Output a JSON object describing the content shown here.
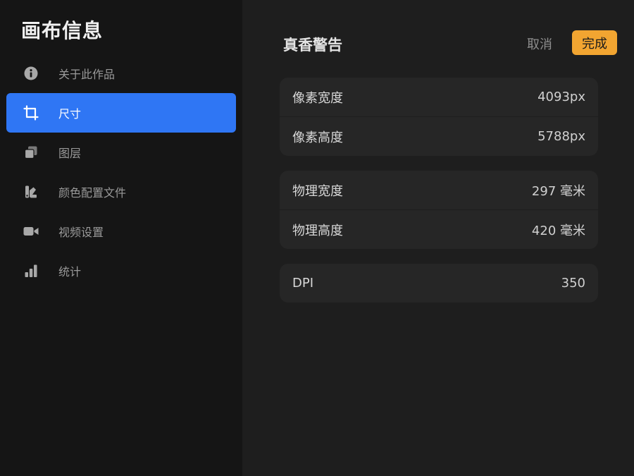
{
  "sidebar": {
    "title": "画布信息",
    "items": [
      {
        "label": "关于此作品",
        "icon": "info-icon",
        "active": false
      },
      {
        "label": "尺寸",
        "icon": "crop-icon",
        "active": true
      },
      {
        "label": "图层",
        "icon": "layers-icon",
        "active": false
      },
      {
        "label": "颜色配置文件",
        "icon": "color-swatch-icon",
        "active": false
      },
      {
        "label": "视频设置",
        "icon": "video-camera-icon",
        "active": false
      },
      {
        "label": "统计",
        "icon": "bar-chart-icon",
        "active": false
      }
    ]
  },
  "header": {
    "title": "真香警告",
    "cancel_label": "取消",
    "done_label": "完成"
  },
  "colors": {
    "accent_blue": "#2f76f4",
    "done_orange": "#f2a531"
  },
  "groups": {
    "pixels": {
      "width_label": "像素宽度",
      "width_value": "4093px",
      "height_label": "像素高度",
      "height_value": "5788px"
    },
    "physical": {
      "width_label": "物理宽度",
      "width_value": "297 毫米",
      "height_label": "物理高度",
      "height_value": "420 毫米"
    },
    "dpi": {
      "label": "DPI",
      "value": "350"
    }
  }
}
